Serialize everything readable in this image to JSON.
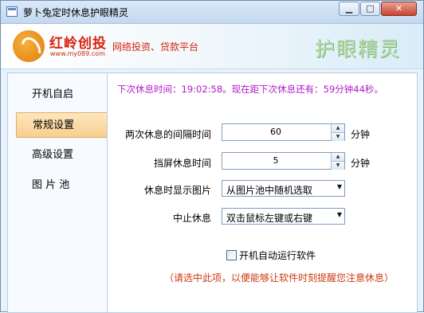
{
  "window": {
    "title": "萝卜兔定时休息护眼精灵"
  },
  "window_controls": {
    "minimize": "▁",
    "maximize": "□",
    "close": "✕"
  },
  "banner": {
    "brand_name": "红岭创投",
    "brand_url": "www.my089.com",
    "slogan": "网络投资、贷款平台",
    "product_title": "护眼精灵"
  },
  "sidebar": {
    "items": [
      {
        "label": "开机自启"
      },
      {
        "label": "常规设置",
        "active": true
      },
      {
        "label": "高级设置"
      },
      {
        "label": "图 片 池"
      }
    ]
  },
  "status": {
    "text": "下次休息时间：19:02:58。现在距下次休息还有：59分钟44秒。"
  },
  "settings": {
    "interval": {
      "label": "两次休息的间隔时间",
      "value": "60",
      "unit": "分钟"
    },
    "lock_time": {
      "label": "挡屏休息时间",
      "value": "5",
      "unit": "分钟"
    },
    "picture": {
      "label": "休息时显示图片",
      "selected": "从图片池中随机选取"
    },
    "stop_rest": {
      "label": "中止休息",
      "selected": "双击鼠标左键或右键"
    },
    "autostart": {
      "label": "开机自动运行软件",
      "checked": false
    },
    "hint": "（请选中此项，以便能够让软件时刻提醒您注意休息）"
  }
}
